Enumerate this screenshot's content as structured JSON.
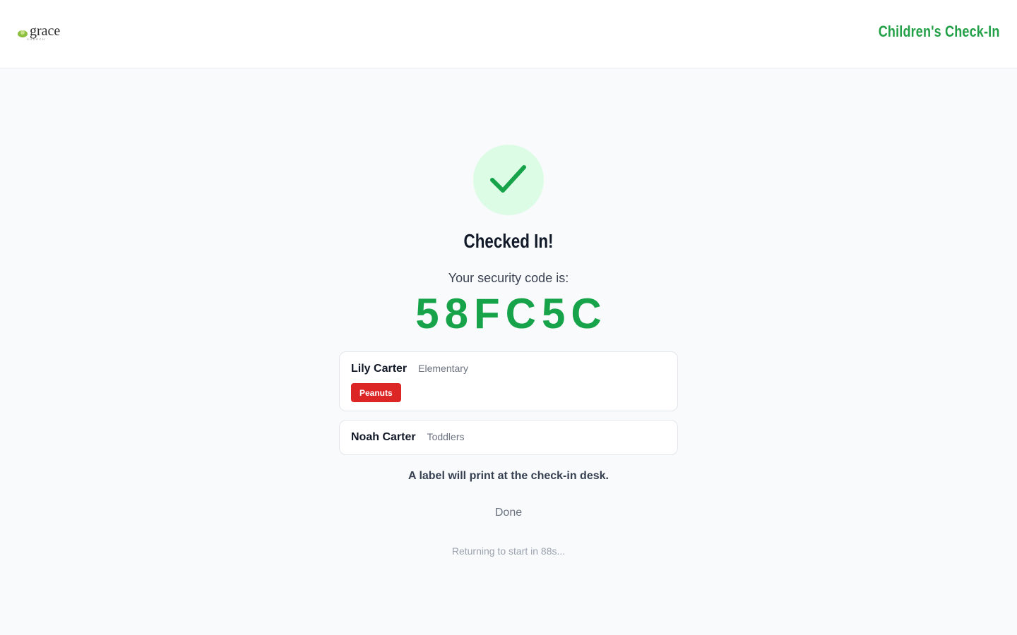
{
  "header": {
    "logo_text": "grace",
    "logo_sub": "CHURCH",
    "title": "Children's Check-In"
  },
  "confirmation": {
    "icon": "checkmark-icon",
    "heading": "Checked In!",
    "code_label": "Your security code is:",
    "security_code": "58FC5C"
  },
  "children": [
    {
      "name": "Lily Carter",
      "group": "Elementary",
      "allergy": "Peanuts"
    },
    {
      "name": "Noah Carter",
      "group": "Toddlers"
    }
  ],
  "print_note": "A label will print at the check-in desk.",
  "done_label": "Done",
  "countdown": "Returning to start in 88s...",
  "colors": {
    "accent": "#16a34a",
    "check_bg": "#dcfce5",
    "allergy_badge": "#dc2626"
  }
}
